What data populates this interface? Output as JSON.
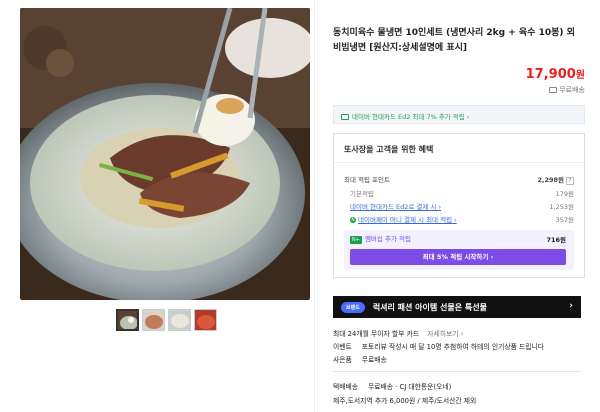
{
  "product": {
    "title": "동치미육수 물냉면 10인세트 (냉면사리 2kg + 육수 10봉) 외 비빔냉면 [원산지:상세설명에 표시]",
    "price": "17,900",
    "price_unit": "원",
    "shipping": "무료배송"
  },
  "card_banner": "네이버 현대카드 Ed2 최대 7% 추가 적립 ›",
  "benefit": {
    "heading": "또사장을 고객을 위한 혜택",
    "max_points_label": "최대 적립 포인트",
    "max_points_value": "2,298원",
    "help": "?",
    "rows": [
      {
        "label": "기본적립",
        "value": "179원"
      },
      {
        "label": "네이버 현대카드 Ed2로 결제 시 ›",
        "value": "1,253원"
      },
      {
        "label": "네이버페이 머니 결제 시 최대 적립 ›",
        "value": "357원"
      }
    ],
    "membership_tag": "N+",
    "membership_label": "멤버십 추가 적립",
    "membership_value": "716원",
    "membership_button": "최대 5% 적립 시작하기 ›"
  },
  "promo": {
    "tag": "브랜드",
    "text": "럭셔리 패션 아이템 선물은 특선물",
    "arrow": "›"
  },
  "info": {
    "installment": "최대 24개월 무이자 할부 카드",
    "installment_link": "자세히보기 ›",
    "event_key": "이벤트",
    "event_text": "포토리뷰 작성시 매 달 10명 추첨하여 하테의 인기상품 드립니다",
    "gift_key": "사은품",
    "gift_text": "무료배송",
    "delivery_key": "택배배송",
    "delivery_text": "무료배송 · CJ 대한통운(오네)",
    "extra_fee": "제주,도서지역 추가 6,000원 / 제주/도서산간 제외"
  },
  "icons": {
    "card": "card-icon",
    "truck": "truck-icon",
    "npay": "npay-icon"
  },
  "colors": {
    "price": "#e91e1e",
    "membership": "#7b4de6",
    "card_green": "#2a9b4d"
  }
}
